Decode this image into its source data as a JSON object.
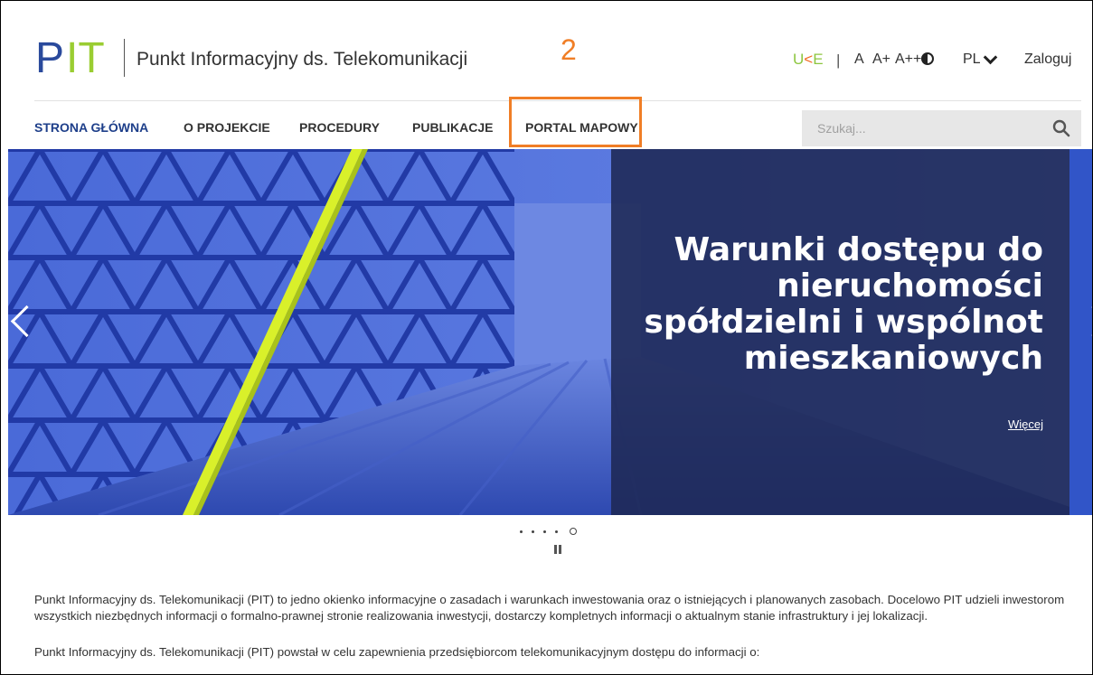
{
  "header": {
    "logo_text": "PIT",
    "site_title": "Punkt Informacyjny ds. Telekomunikacji",
    "annotation_number": "2",
    "uke_logo": "UKE",
    "util_separator": "|",
    "font_sizes": [
      "A",
      "A+",
      "A++"
    ],
    "contrast_icon": "contrast-icon",
    "language": "PL",
    "login": "Zaloguj"
  },
  "nav": {
    "items": [
      {
        "label": "STRONA GŁÓWNA",
        "active": true
      },
      {
        "label": "O PROJEKCIE"
      },
      {
        "label": "PROCEDURY"
      },
      {
        "label": "PUBLIKACJE"
      },
      {
        "label": "PORTAL MAPOWY",
        "highlighted": true
      }
    ]
  },
  "search": {
    "placeholder": "Szukaj...",
    "icon": "search-icon"
  },
  "banner": {
    "title": "Warunki dostępu do nieruchomości spółdzielni i wspólnot mieszkaniowych",
    "more_link": "Więcej",
    "slides_total": 5,
    "current_slide": 5
  },
  "content": {
    "paragraph1": "Punkt Informacyjny ds. Telekomunikacji (PIT) to jedno okienko informacyjne o zasadach i warunkach inwestowania oraz o istniejących i planowanych zasobach. Docelowo PIT udzieli inwestorom wszystkich niezbędnych informacji o formalno-prawnej stronie realizowania inwestycji, dostarczy kompletnych informacji o aktualnym stanie infrastruktury i jej lokalizacji.",
    "paragraph2": "Punkt Informacyjny ds. Telekomunikacji (PIT) powstał w celu zapewnienia przedsiębiorcom telekomunikacyjnym dostępu do informacji o:"
  },
  "colors": {
    "brand_blue": "#1e3f8a",
    "brand_green": "#9acd32",
    "highlight_orange": "#f07e26"
  }
}
